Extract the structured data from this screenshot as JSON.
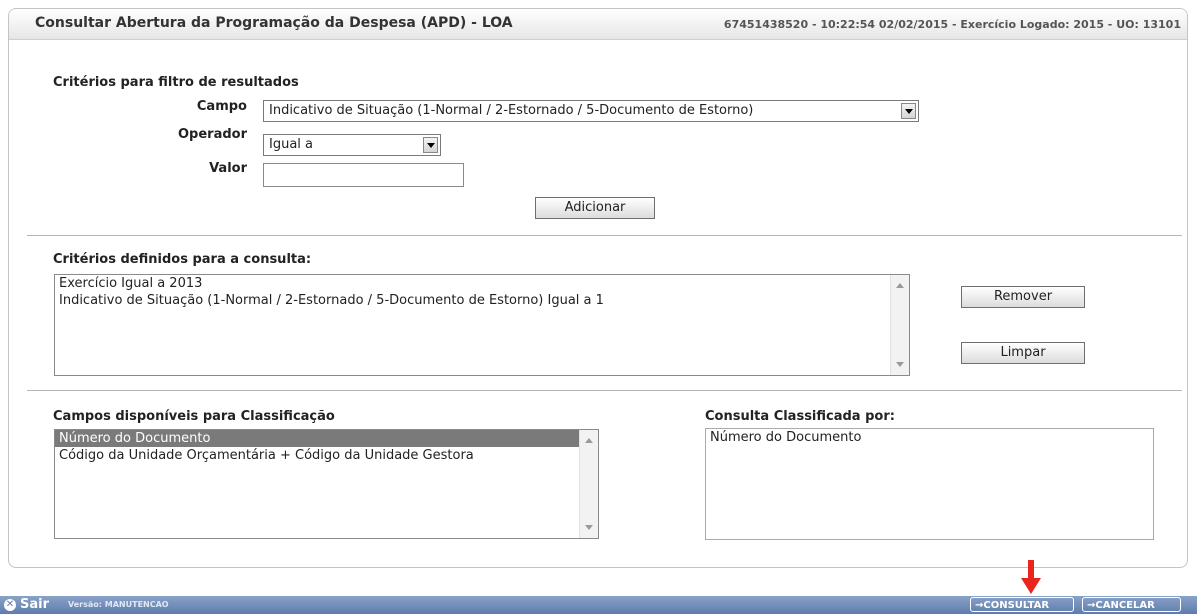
{
  "header": {
    "title": "Consultar Abertura da Programação da Despesa (APD) - LOA",
    "info": "67451438520 - 10:22:54 02/02/2015 - Exercício Logado: 2015 - UO: 13101"
  },
  "filter": {
    "section_title": "Critérios para filtro de resultados",
    "campo_label": "Campo",
    "campo_value": "Indicativo de Situação (1-Normal / 2-Estornado / 5-Documento de Estorno)",
    "operador_label": "Operador",
    "operador_value": "Igual a",
    "valor_label": "Valor",
    "valor_value": "",
    "add_button": "Adicionar"
  },
  "criteria": {
    "section_title": "Critérios definidos para a consulta:",
    "items": [
      "Exercício Igual a 2013",
      "Indicativo de Situação (1-Normal / 2-Estornado / 5-Documento de Estorno) Igual a 1"
    ],
    "remove_button": "Remover",
    "clear_button": "Limpar"
  },
  "sort": {
    "available_title": "Campos disponíveis para Classificação",
    "available_items": [
      "Número do Documento",
      "Código da Unidade Orçamentária + Código da Unidade Gestora"
    ],
    "selected_title": "Consulta Classificada por:",
    "selected_items": [
      "Número do Documento"
    ]
  },
  "footer": {
    "exit_label": "Sair",
    "version": "Versão: MANUTENCAO",
    "consult_button": "→CONSULTAR",
    "cancel_button": "→CANCELAR"
  },
  "colors": {
    "footer_bar": "#5d7cad",
    "selected_item": "#7a7a7a",
    "arrow": "#e8261c"
  }
}
